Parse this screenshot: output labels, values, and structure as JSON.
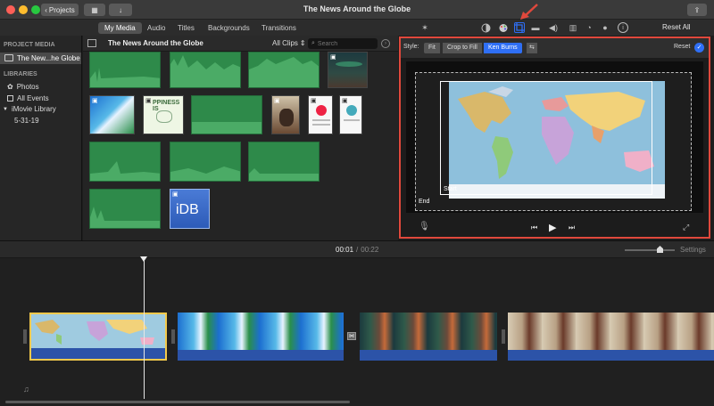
{
  "window": {
    "title": "The News Around the Globe",
    "projects_label": "Projects"
  },
  "browser_tabs": [
    {
      "label": "My Media",
      "active": true
    },
    {
      "label": "Audio",
      "active": false
    },
    {
      "label": "Titles",
      "active": false
    },
    {
      "label": "Backgrounds",
      "active": false
    },
    {
      "label": "Transitions",
      "active": false
    }
  ],
  "viewer_toolbar": {
    "reset_all_label": "Reset All",
    "icons": [
      "magic-wand-icon",
      "color-balance-icon",
      "color-correction-icon",
      "crop-icon",
      "stabilization-icon",
      "volume-icon",
      "equalizer-icon",
      "speed-icon",
      "filter-icon",
      "info-icon"
    ]
  },
  "sidebar": {
    "project_media_header": "PROJECT MEDIA",
    "project_item": "The New...he Globe",
    "libraries_header": "LIBRARIES",
    "items": [
      {
        "label": "Photos",
        "icon": "photos-icon"
      },
      {
        "label": "All Events",
        "icon": "events-icon"
      }
    ],
    "library_name": "iMovie Library",
    "event_date": "5-31-19"
  },
  "browser_header": {
    "title": "The News Around the Globe",
    "filter": "All Clips",
    "search_placeholder": "Search"
  },
  "media_thumbs": {
    "happiness_text": "PPINESS IS",
    "idb_text": "iDB"
  },
  "crop_panel": {
    "style_label": "Style:",
    "options": [
      "Fit",
      "Crop to Fill",
      "Ken Burns"
    ],
    "selected": "Ken Burns",
    "reset_label": "Reset",
    "start_label": "Start",
    "end_label": "End"
  },
  "timeline": {
    "current_time": "00:01",
    "separator": "/",
    "total_time": "00:22",
    "settings_label": "Settings"
  },
  "colors": {
    "accent": "#2f6ff5",
    "highlight": "#e0483c",
    "clip_green": "#2e8a4a",
    "audio_blue": "#2c53a8",
    "selection_yellow": "#f2c94c"
  }
}
